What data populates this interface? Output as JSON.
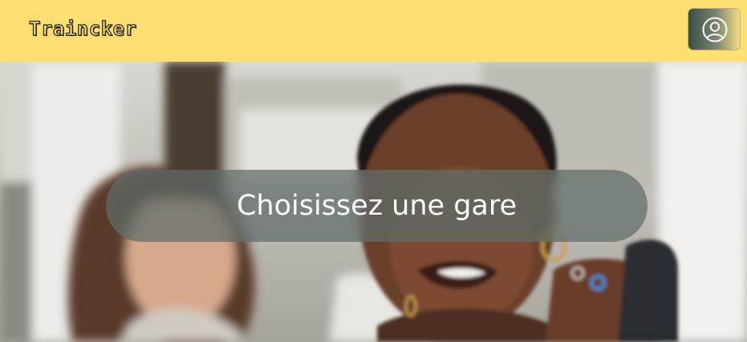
{
  "header": {
    "logo_text": "Traincker",
    "background_color": "#ffde72",
    "profile_icon": "user-circle-icon"
  },
  "hero": {
    "image_description_icon": "photo",
    "cta_label": "Choisissez une gare"
  }
}
